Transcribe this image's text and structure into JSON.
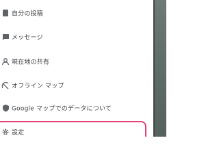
{
  "menu": {
    "items": [
      {
        "label": "自分の投稿",
        "icon": "posts-icon"
      },
      {
        "label": "メッセージ",
        "icon": "message-icon"
      },
      {
        "label": "現在地の共有",
        "icon": "location-share-icon"
      },
      {
        "label": "オフライン マップ",
        "icon": "offline-map-icon"
      },
      {
        "label": "Google マップでのデータについて",
        "icon": "data-icon"
      },
      {
        "label": "設定",
        "icon": "settings-icon"
      }
    ]
  },
  "colors": {
    "highlight": "#e3417a",
    "text": "#3c4043",
    "icon": "#5f6368"
  }
}
